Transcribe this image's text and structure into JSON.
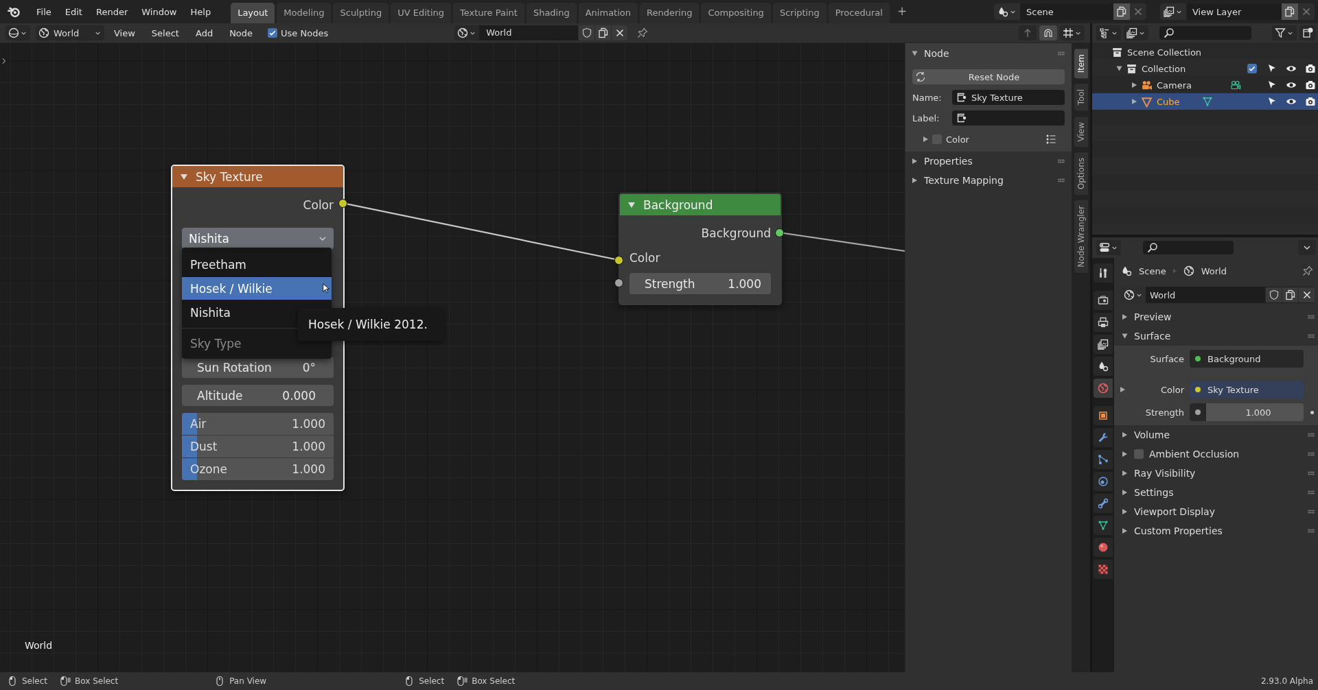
{
  "topbar": {
    "menus": [
      "File",
      "Edit",
      "Render",
      "Window",
      "Help"
    ],
    "workspaces": [
      {
        "label": "Layout",
        "selected": true
      },
      {
        "label": "Modeling",
        "selected": false
      },
      {
        "label": "Sculpting",
        "selected": false
      },
      {
        "label": "UV Editing",
        "selected": false
      },
      {
        "label": "Texture Paint",
        "selected": false
      },
      {
        "label": "Shading",
        "selected": false
      },
      {
        "label": "Animation",
        "selected": false
      },
      {
        "label": "Rendering",
        "selected": false
      },
      {
        "label": "Compositing",
        "selected": false
      },
      {
        "label": "Scripting",
        "selected": false
      },
      {
        "label": "Procedural",
        "selected": false
      }
    ],
    "add_button": "+",
    "scene": "Scene",
    "view_layer": "View Layer"
  },
  "node_header": {
    "world_type": "World",
    "menus": [
      "View",
      "Select",
      "Add",
      "Node"
    ],
    "use_nodes": {
      "label": "Use Nodes",
      "checked": true
    },
    "datablock": "World"
  },
  "canvas": {
    "context_label": "World",
    "nodes": [
      {
        "kind": "sky",
        "title": "Sky Texture",
        "selected": true,
        "output": "Color",
        "sky_type": "Nishita",
        "fields": [
          {
            "kind": "number",
            "label": "Sun Rotation",
            "value": "0°"
          },
          {
            "kind": "number",
            "label": "Altitude",
            "value": "0.000"
          },
          {
            "kind": "slider",
            "label": "Air",
            "value": "1.000",
            "level": 0.1
          },
          {
            "kind": "slider",
            "label": "Dust",
            "value": "1.000",
            "level": 0.1
          },
          {
            "kind": "slider",
            "label": "Ozone",
            "value": "1.000",
            "level": 0.1
          }
        ]
      },
      {
        "kind": "shader",
        "title": "Background",
        "selected": false,
        "output": "Background",
        "input": "Color",
        "fields": [
          {
            "kind": "number",
            "label": "Strength",
            "value": "1.000"
          }
        ]
      }
    ],
    "menu": {
      "items": [
        {
          "label": "Preetham",
          "selected": false
        },
        {
          "label": "Hosek / Wilkie",
          "selected": true
        },
        {
          "label": "Nishita",
          "selected": false
        }
      ],
      "title": "Sky Type"
    },
    "tooltip": "Hosek / Wilkie 2012."
  },
  "sidebar": {
    "tabs": [
      {
        "label": "Item",
        "selected": true
      },
      {
        "label": "Tool",
        "selected": false
      },
      {
        "label": "View",
        "selected": false
      },
      {
        "label": "Options",
        "selected": false
      },
      {
        "label": "Node Wrangler",
        "selected": false
      }
    ],
    "panel": {
      "title": "Node",
      "expanded": true
    },
    "reset_button": "Reset Node",
    "fields": [
      {
        "label": "Name:",
        "value": "Sky Texture"
      },
      {
        "label": "Label:"
      }
    ],
    "color_row": {
      "label": "Color",
      "checked": false,
      "expanded": false
    },
    "sections": [
      {
        "label": "Properties",
        "expanded": false
      },
      {
        "label": "Texture Mapping",
        "expanded": false
      }
    ]
  },
  "outliner": {
    "scene_collection": {
      "label": "Scene Collection",
      "selected": false
    },
    "collections": [
      {
        "label": "Collection",
        "expanded": true,
        "checked": true,
        "selected": false,
        "children": [
          {
            "kind": "camera",
            "label": "Camera",
            "expanded": false,
            "selected": false
          },
          {
            "kind": "mesh",
            "label": "Cube",
            "expanded": false,
            "selected": true
          }
        ]
      }
    ]
  },
  "properties": {
    "tabs": [
      {
        "selected": false
      },
      {
        "selected": false
      },
      {
        "selected": false
      },
      {
        "selected": false
      },
      {
        "selected": false
      },
      {
        "selected": true
      },
      {
        "selected": false
      },
      {
        "selected": false
      },
      {
        "selected": false
      },
      {
        "selected": false
      },
      {
        "selected": false
      },
      {
        "selected": false
      },
      {
        "selected": false
      },
      {
        "selected": false
      }
    ],
    "breadcrumb": [
      "Scene",
      "World"
    ],
    "world": "World",
    "panels": [
      {
        "label": "Preview",
        "expanded": false
      },
      {
        "label": "Surface",
        "expanded": true,
        "rows": [
          {
            "kind": "shader",
            "label": "Surface",
            "value": "Background",
            "color": "#4fbf4f"
          },
          {
            "kind": "link",
            "label": "Color",
            "value": "Sky Texture",
            "color": "#c8c82a",
            "expanded": false
          },
          {
            "kind": "number",
            "label": "Strength",
            "value": "1.000",
            "color": "#a1a1a1"
          }
        ]
      },
      {
        "label": "Volume",
        "expanded": false
      },
      {
        "label": "Ambient Occlusion",
        "expanded": false,
        "checked": false
      },
      {
        "label": "Ray Visibility",
        "expanded": false
      },
      {
        "label": "Settings",
        "expanded": false
      },
      {
        "label": "Viewport Display",
        "expanded": false
      },
      {
        "label": "Custom Properties",
        "expanded": false
      }
    ]
  },
  "status_bar": {
    "groups": [
      {
        "items": [
          {
            "kind": "left",
            "label": "Select"
          },
          {
            "kind": "drag",
            "label": "Box Select"
          }
        ]
      },
      {
        "items": [
          {
            "kind": "middle",
            "label": "Pan View"
          }
        ]
      },
      {
        "items": [
          {
            "kind": "left",
            "label": "Select"
          },
          {
            "kind": "drag",
            "label": "Box Select"
          }
        ]
      }
    ],
    "version": "2.93.0 Alpha"
  }
}
